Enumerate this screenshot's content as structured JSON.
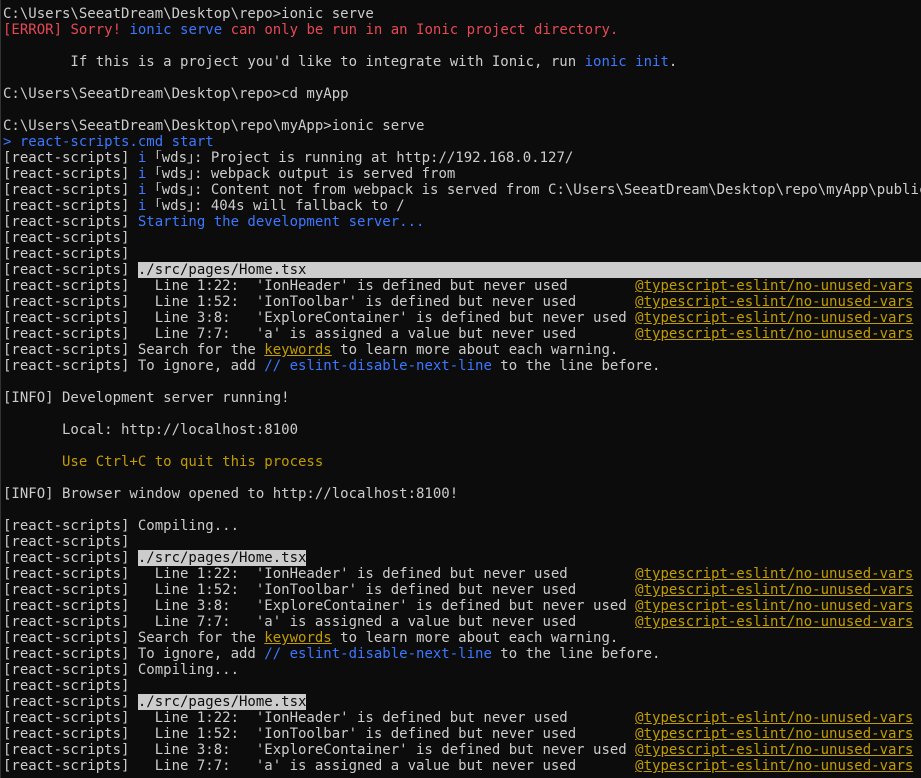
{
  "terminal": {
    "lines": [
      [
        {
          "t": "C:\\Users\\SeeatDream\\Desktop\\repo>ionic serve",
          "c": "gray"
        }
      ],
      [
        {
          "t": "[ERROR] ",
          "c": "red"
        },
        {
          "t": "Sorry! ",
          "c": "red"
        },
        {
          "t": "ionic serve",
          "c": "blue"
        },
        {
          "t": " can only be run in an Ionic project directory.",
          "c": "red"
        }
      ],
      [
        {
          "t": "",
          "c": "gray"
        }
      ],
      [
        {
          "t": "        If this is a project you'd like to integrate with Ionic, run ",
          "c": "gray"
        },
        {
          "t": "ionic init",
          "c": "blue"
        },
        {
          "t": ".",
          "c": "gray"
        }
      ],
      [
        {
          "t": "",
          "c": "gray"
        }
      ],
      [
        {
          "t": "C:\\Users\\SeeatDream\\Desktop\\repo>cd myApp",
          "c": "gray"
        }
      ],
      [
        {
          "t": "",
          "c": "gray"
        }
      ],
      [
        {
          "t": "C:\\Users\\SeeatDream\\Desktop\\repo\\myApp>ionic serve",
          "c": "gray"
        }
      ],
      [
        {
          "t": "> ",
          "c": "blue"
        },
        {
          "t": "react-scripts.cmd start",
          "c": "blue"
        }
      ],
      [
        {
          "t": "[react-scripts] ",
          "c": "gray"
        },
        {
          "t": "i ",
          "c": "blue"
        },
        {
          "t": "｢wds｣",
          "c": "gray"
        },
        {
          "t": ": Project is running at http://192.168.0.127/",
          "c": "gray"
        }
      ],
      [
        {
          "t": "[react-scripts] ",
          "c": "gray"
        },
        {
          "t": "i ",
          "c": "blue"
        },
        {
          "t": "｢wds｣",
          "c": "gray"
        },
        {
          "t": ": webpack output is served from",
          "c": "gray"
        }
      ],
      [
        {
          "t": "[react-scripts] ",
          "c": "gray"
        },
        {
          "t": "i ",
          "c": "blue"
        },
        {
          "t": "｢wds｣",
          "c": "gray"
        },
        {
          "t": ": Content not from webpack is served from C:\\Users\\SeeatDream\\Desktop\\repo\\myApp\\public",
          "c": "gray"
        }
      ],
      [
        {
          "t": "[react-scripts] ",
          "c": "gray"
        },
        {
          "t": "i ",
          "c": "blue"
        },
        {
          "t": "｢wds｣",
          "c": "gray"
        },
        {
          "t": ": 404s will fallback to /",
          "c": "gray"
        }
      ],
      [
        {
          "t": "[react-scripts] ",
          "c": "gray"
        },
        {
          "t": "Starting the development server...",
          "c": "blue"
        }
      ],
      [
        {
          "t": "[react-scripts]",
          "c": "gray"
        }
      ],
      [
        {
          "t": "[react-scripts]",
          "c": "gray"
        }
      ],
      [
        {
          "t": "[react-scripts] ",
          "c": "gray"
        },
        {
          "t": "./src/pages/Home.tsx",
          "c": "hl-full"
        }
      ],
      [
        {
          "t": "[react-scripts]   Line 1:22:  'IonHeader' is defined but never used        ",
          "c": "gray"
        },
        {
          "t": "@typescript-eslint/no-unused-vars",
          "c": "link"
        }
      ],
      [
        {
          "t": "[react-scripts]   Line 1:52:  'IonToolbar' is defined but never used       ",
          "c": "gray"
        },
        {
          "t": "@typescript-eslint/no-unused-vars",
          "c": "link"
        }
      ],
      [
        {
          "t": "[react-scripts]   Line 3:8:   'ExploreContainer' is defined but never used ",
          "c": "gray"
        },
        {
          "t": "@typescript-eslint/no-unused-vars",
          "c": "link"
        }
      ],
      [
        {
          "t": "[react-scripts]   Line 7:7:   'a' is assigned a value but never used       ",
          "c": "gray"
        },
        {
          "t": "@typescript-eslint/no-unused-vars",
          "c": "link"
        }
      ],
      [
        {
          "t": "[react-scripts] Search for the ",
          "c": "gray"
        },
        {
          "t": "keywords",
          "c": "link"
        },
        {
          "t": " to learn more about each warning.",
          "c": "gray"
        }
      ],
      [
        {
          "t": "[react-scripts] To ignore, add ",
          "c": "gray"
        },
        {
          "t": "// eslint-disable-next-line",
          "c": "blue"
        },
        {
          "t": " to the line before.",
          "c": "gray"
        }
      ],
      [
        {
          "t": "",
          "c": "gray"
        }
      ],
      [
        {
          "t": "[INFO] Development server running!",
          "c": "gray"
        }
      ],
      [
        {
          "t": "",
          "c": "gray"
        }
      ],
      [
        {
          "t": "       Local: http://localhost:8100",
          "c": "gray"
        }
      ],
      [
        {
          "t": "",
          "c": "gray"
        }
      ],
      [
        {
          "t": "       Use Ctrl+C to quit this process",
          "c": "yellow"
        }
      ],
      [
        {
          "t": "",
          "c": "gray"
        }
      ],
      [
        {
          "t": "[INFO] Browser window opened to http://localhost:8100!",
          "c": "gray"
        }
      ],
      [
        {
          "t": "",
          "c": "gray"
        }
      ],
      [
        {
          "t": "[react-scripts] Compiling...",
          "c": "gray"
        }
      ],
      [
        {
          "t": "[react-scripts]",
          "c": "gray"
        }
      ],
      [
        {
          "t": "[react-scripts] ",
          "c": "gray"
        },
        {
          "t": "./src/pages/Home.tsx",
          "c": "hl"
        }
      ],
      [
        {
          "t": "[react-scripts]   Line 1:22:  'IonHeader' is defined but never used        ",
          "c": "gray"
        },
        {
          "t": "@typescript-eslint/no-unused-vars",
          "c": "link"
        }
      ],
      [
        {
          "t": "[react-scripts]   Line 1:52:  'IonToolbar' is defined but never used       ",
          "c": "gray"
        },
        {
          "t": "@typescript-eslint/no-unused-vars",
          "c": "link"
        }
      ],
      [
        {
          "t": "[react-scripts]   Line 3:8:   'ExploreContainer' is defined but never used ",
          "c": "gray"
        },
        {
          "t": "@typescript-eslint/no-unused-vars",
          "c": "link"
        }
      ],
      [
        {
          "t": "[react-scripts]   Line 7:7:   'a' is assigned a value but never used       ",
          "c": "gray"
        },
        {
          "t": "@typescript-eslint/no-unused-vars",
          "c": "link"
        }
      ],
      [
        {
          "t": "[react-scripts] Search for the ",
          "c": "gray"
        },
        {
          "t": "keywords",
          "c": "link"
        },
        {
          "t": " to learn more about each warning.",
          "c": "gray"
        }
      ],
      [
        {
          "t": "[react-scripts] To ignore, add ",
          "c": "gray"
        },
        {
          "t": "// eslint-disable-next-line",
          "c": "blue"
        },
        {
          "t": " to the line before.",
          "c": "gray"
        }
      ],
      [
        {
          "t": "[react-scripts] Compiling...",
          "c": "gray"
        }
      ],
      [
        {
          "t": "[react-scripts]",
          "c": "gray"
        }
      ],
      [
        {
          "t": "[react-scripts] ",
          "c": "gray"
        },
        {
          "t": "./src/pages/Home.tsx",
          "c": "hl"
        }
      ],
      [
        {
          "t": "[react-scripts]   Line 1:22:  'IonHeader' is defined but never used        ",
          "c": "gray"
        },
        {
          "t": "@typescript-eslint/no-unused-vars",
          "c": "link"
        }
      ],
      [
        {
          "t": "[react-scripts]   Line 1:52:  'IonToolbar' is defined but never used       ",
          "c": "gray"
        },
        {
          "t": "@typescript-eslint/no-unused-vars",
          "c": "link"
        }
      ],
      [
        {
          "t": "[react-scripts]   Line 3:8:   'ExploreContainer' is defined but never used ",
          "c": "gray"
        },
        {
          "t": "@typescript-eslint/no-unused-vars",
          "c": "link"
        }
      ],
      [
        {
          "t": "[react-scripts]   Line 7:7:   'a' is assigned a value but never used       ",
          "c": "gray"
        },
        {
          "t": "@typescript-eslint/no-unused-vars",
          "c": "link"
        }
      ]
    ]
  },
  "colors": {
    "background": "#0c0c0c",
    "gray": "#cccccc",
    "red": "#e74856",
    "blue": "#3b78ff",
    "yellow": "#c19c00",
    "highlight_bg": "#cccccc"
  }
}
